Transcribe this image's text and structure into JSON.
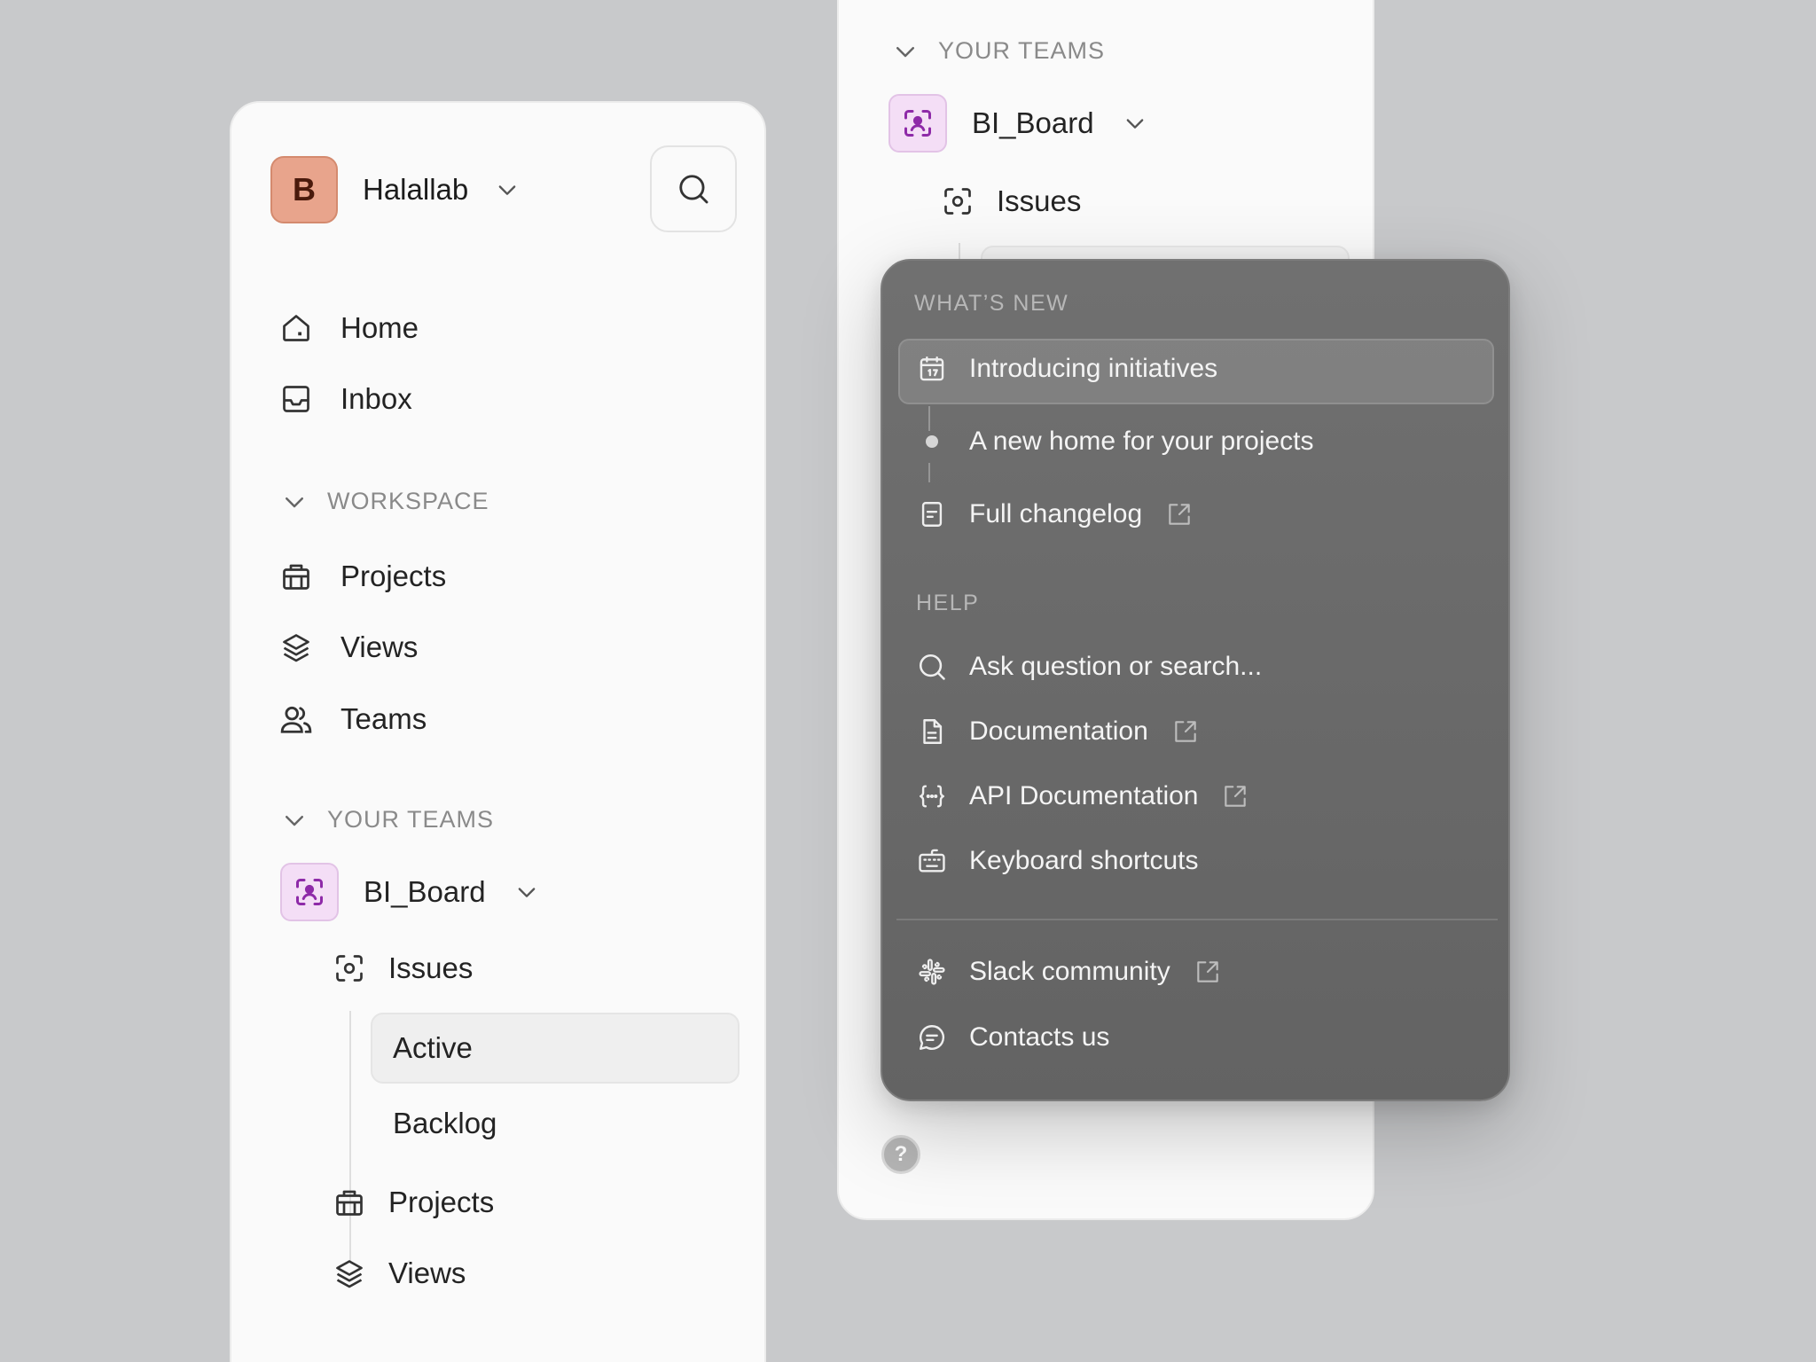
{
  "workspace": {
    "avatar_letter": "B",
    "name": "Halallab"
  },
  "nav": {
    "home": "Home",
    "inbox": "Inbox"
  },
  "workspace_section": {
    "title": "WORKSPACE",
    "items": {
      "projects": "Projects",
      "views": "Views",
      "teams": "Teams"
    }
  },
  "teams_section": {
    "title": "YOUR TEAMS",
    "team_name": "BI_Board",
    "issues": "Issues",
    "active": "Active",
    "backlog": "Backlog",
    "projects": "Projects",
    "views": "Views"
  },
  "help_menu": {
    "whats_new_title": "WHAT’S NEW",
    "whats_new_items": {
      "introducing": "Introducing initiatives",
      "new_home": "A new home for your projects",
      "changelog": "Full changelog"
    },
    "help_title": "HELP",
    "help_items": {
      "ask": "Ask question or search...",
      "documentation": "Documentation",
      "api_documentation": "API Documentation",
      "keyboard_shortcuts": "Keyboard shortcuts"
    },
    "community_items": {
      "slack": "Slack community",
      "contacts": "Contacts us"
    }
  },
  "help_button": "?",
  "colors": {
    "background": "#c8c9cb",
    "avatar": "#e8a48c",
    "team_icon_bg": "#f4def6",
    "team_icon": "#8e2aa8",
    "popover": "#6b6b6b"
  }
}
